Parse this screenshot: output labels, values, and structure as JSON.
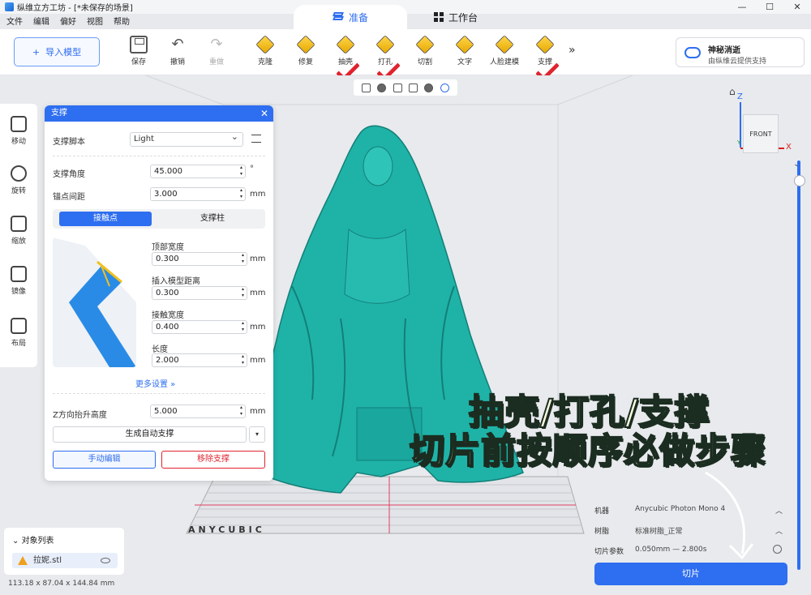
{
  "window": {
    "title": "纵维立方工坊 - [*未保存的场景]",
    "controls": [
      "—",
      "☐",
      "✕"
    ]
  },
  "menu": [
    "文件",
    "编辑",
    "偏好",
    "视图",
    "帮助"
  ],
  "modes": {
    "prepare": "准备",
    "workbench": "工作台"
  },
  "toolbar": {
    "import": "导入模型",
    "tools": [
      "保存",
      "撤销",
      "重做",
      "克隆",
      "修复",
      "抽壳",
      "打孔",
      "切割",
      "文字",
      "人脸建模",
      "支撑"
    ],
    "more": "»"
  },
  "cloud": {
    "title": "神秘消逝",
    "subtitle": "由纵维云提供支持"
  },
  "left_tools": [
    "移动",
    "旋转",
    "缩放",
    "镜像",
    "布局"
  ],
  "orientation": {
    "face": "FRONT",
    "z": "Z",
    "x": "X",
    "y": "Y"
  },
  "support_panel": {
    "title": "支撑",
    "preset_label": "支撑脚本",
    "preset_value": "Light",
    "angle_label": "支撑角度",
    "angle_value": "45.000",
    "angle_unit": "°",
    "spacing_label": "锚点间距",
    "spacing_value": "3.000",
    "spacing_unit": "mm",
    "tabs": [
      "接触点",
      "支撑柱"
    ],
    "top_width_label": "顶部宽度",
    "top_width_value": "0.300",
    "insert_label": "插入模型距离",
    "insert_value": "0.300",
    "contact_width_label": "接触宽度",
    "contact_width_value": "0.400",
    "length_label": "长度",
    "length_value": "2.000",
    "unit": "mm",
    "more_settings": "更多设置 »",
    "z_lift_label": "Z方向抬升高度",
    "z_lift_value": "5.000",
    "generate": "生成自动支撑",
    "manual": "手动编辑",
    "remove": "移除支撑"
  },
  "object_list": {
    "title": "对象列表",
    "item": "拉妮.stl",
    "dims": "113.18 x 87.04 x 144.84 mm"
  },
  "print": {
    "machine_label": "机器",
    "machine_value": "Anycubic Photon Mono 4",
    "resin_label": "树脂",
    "resin_value": "标准树脂_正常",
    "slice_label": "切片参数",
    "slice_value": "0.050mm — 2.800s",
    "slice_button": "切片"
  },
  "brand": "ANYCUBIC",
  "overlay": {
    "line1": "抽壳/打孔/支撑",
    "line2": "切片前按顺序必做步骤"
  },
  "colors": {
    "accent": "#2e6ef0",
    "model": "#1fb3a8",
    "check": "#e0242e"
  }
}
